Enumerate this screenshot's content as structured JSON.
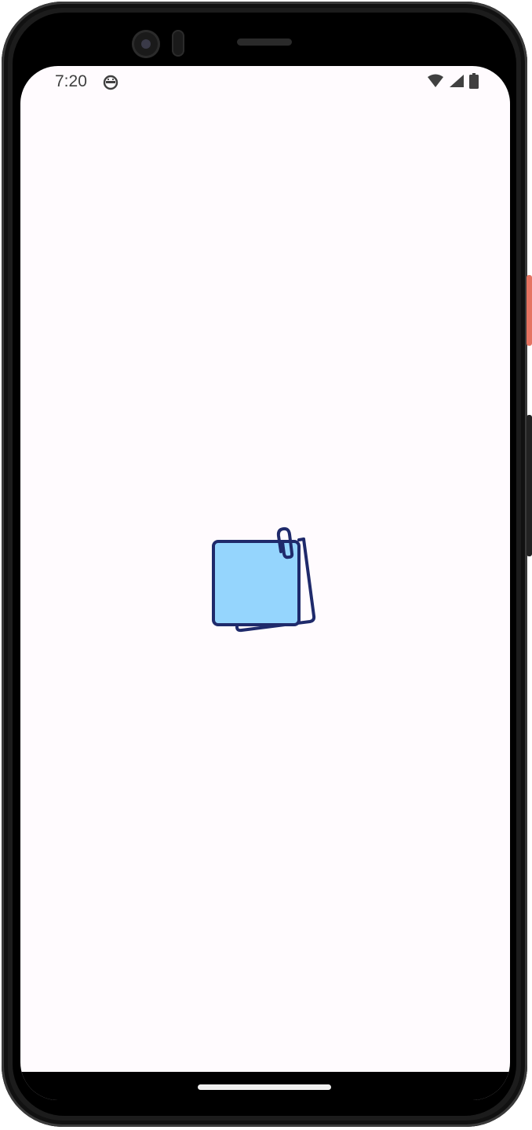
{
  "status_bar": {
    "time": "7:20",
    "notification_icon": "android-debug-icon",
    "icons": [
      "wifi-icon",
      "cellular-signal-icon",
      "battery-icon"
    ]
  },
  "splash": {
    "logo_icon": "sticky-notes-icon",
    "colors": {
      "note_fill": "#95d5fd",
      "outline": "#1f2a6b",
      "background": "#fffbfe"
    }
  }
}
